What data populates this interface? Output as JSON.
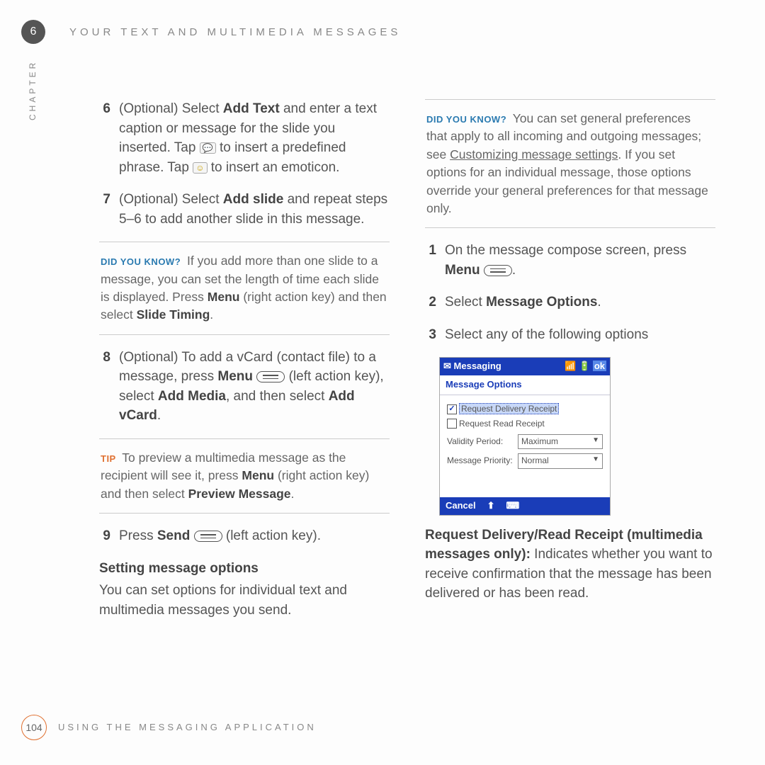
{
  "chapter_num": "6",
  "chapter_label": "CHAPTER",
  "header_title": "YOUR TEXT AND MULTIMEDIA MESSAGES",
  "left": {
    "step6": {
      "num": "6",
      "pre": "(Optional) Select ",
      "bold1": "Add Text",
      "post1": " and enter a text caption or message for the slide you inserted. Tap ",
      "icon1_label": "quick-text-icon",
      "post2": " to insert a predefined phrase. Tap ",
      "icon2_label": "emoticon-icon",
      "post3": " to insert an emoticon."
    },
    "step7": {
      "num": "7",
      "pre": "(Optional) Select ",
      "bold1": "Add slide",
      "post": " and repeat steps 5–6 to add another slide in this message."
    },
    "dyk1": {
      "label": "DID YOU KNOW?",
      "t1": " If you add more than one slide to a message, you can set the length of time each slide is displayed. Press ",
      "b1": "Menu",
      "t2": " (right action key) and then select ",
      "b2": "Slide Timing",
      "t3": "."
    },
    "step8": {
      "num": "8",
      "pre": "(Optional) To add a vCard (contact file) to a message, press ",
      "b1": "Menu",
      "post1": " (left action key), select ",
      "b2": "Add Media",
      "post2": ", and then select ",
      "b3": "Add vCard",
      "post3": "."
    },
    "tip1": {
      "label": "TIP",
      "t1": " To preview a multimedia message as the recipient will see it, press ",
      "b1": "Menu",
      "t2": " (right action key) and then select ",
      "b2": "Preview Message",
      "t3": "."
    },
    "step9": {
      "num": "9",
      "pre": "Press ",
      "b1": "Send",
      "post": " (left action key)."
    },
    "subhead": "Setting message options",
    "subtext": "You can set options for individual text and multimedia messages you send."
  },
  "right": {
    "dyk2": {
      "label": "DID YOU KNOW?",
      "t1": " You can set general preferences that apply to all incoming and outgoing messages; see ",
      "link": "Customizing message settings",
      "t2": ". If you set options for an individual message, those options override your general preferences for that message only."
    },
    "s1": {
      "num": "1",
      "pre": "On the message compose screen, press ",
      "b1": "Menu",
      "post": "."
    },
    "s2": {
      "num": "2",
      "pre": "Select ",
      "b1": "Message Options",
      "post": "."
    },
    "s3": {
      "num": "3",
      "text": "Select any of the following options"
    },
    "phone": {
      "title": "Messaging",
      "ok": "ok",
      "sub": "Message Options",
      "chk1": "Request Delivery Receipt",
      "chk2": "Request Read Receipt",
      "f1label": "Validity Period:",
      "f1val": "Maximum",
      "f2label": "Message Priority:",
      "f2val": "Normal",
      "cancel": "Cancel"
    },
    "para_head": "Request Delivery/Read Receipt (multimedia messages only): ",
    "para_body": "Indicates whether you want to receive confirmation that the message has been delivered or has been read."
  },
  "footer": {
    "page": "104",
    "text": "USING THE MESSAGING APPLICATION"
  }
}
